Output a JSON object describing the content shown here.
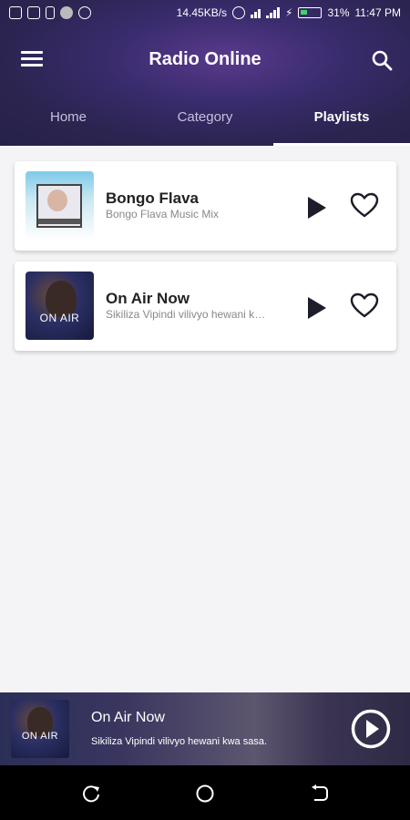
{
  "status_bar": {
    "left_icons": [
      "instagram-icon",
      "cast-icon",
      "phone-icon",
      "dot-icon",
      "target-icon"
    ],
    "speed": "14.45KB/s",
    "battery": "31%",
    "time": "11:47 PM"
  },
  "appbar": {
    "title": "Radio Online",
    "menu_icon": "menu-icon",
    "search_icon": "search-icon"
  },
  "tabs": [
    {
      "label": "Home",
      "active": false
    },
    {
      "label": "Category",
      "active": false
    },
    {
      "label": "Playlists",
      "active": true
    }
  ],
  "playlists": [
    {
      "title": "Bongo Flava",
      "subtitle": "Bongo Flava Music Mix",
      "thumb_text": ""
    },
    {
      "title": "On Air Now",
      "subtitle": "Sikiliza Vipindi vilivyo hewani kwa sasa.",
      "thumb_text": "ON AIR"
    }
  ],
  "mini_player": {
    "title": "On Air Now",
    "subtitle": "Sikiliza Vipindi vilivyo hewani kwa sasa.",
    "thumb_text": "ON AIR"
  },
  "colors": {
    "header": "#2b2450",
    "accent": "#5a3a8c",
    "tab_indicator": "#ffffff"
  }
}
